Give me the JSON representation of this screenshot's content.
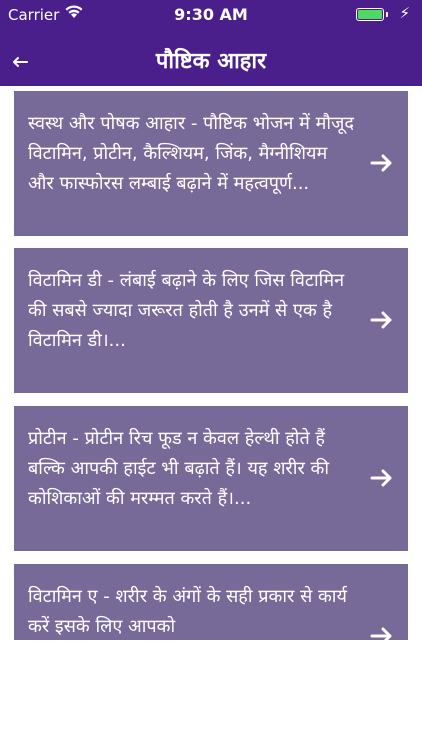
{
  "status": {
    "carrier": "Carrier",
    "time": "9:30 AM",
    "battery_level": 1.0
  },
  "header": {
    "title": "पौष्टिक आहार",
    "back_icon": "left-arrow-icon"
  },
  "articles": [
    {
      "text": "स्वस्थ और पोषक आहार - पौष्टिक भोजन में मौजूद विटामिन, प्रोटीन, कैल्शियम, जिंक, मैग्नीशियम और फास्फोरस लम्बाई बढ़ाने में महत्वपूर्ण..."
    },
    {
      "text": "विटामिन डी - लंबाई बढ़ाने के लिए जिस विटामिन की सबसे ज्यादा जरूरत होती है उनमें से एक है विटामिन डी।..."
    },
    {
      "text": "प्रोटीन - प्रोटीन रिच फूड न केवल हेल्थी होते हैं बल्कि आपकी हाईट भी बढ़ाते हैं। यह शरीर की कोशिकाओं की मरम्मत करते हैं।..."
    },
    {
      "text": "विटामिन ए - शरीर के अंगों के सही प्रकार से कार्य करें इसके लिए आपको"
    }
  ],
  "colors": {
    "header": "#4a1f8c",
    "card": "#776a99",
    "text": "#ffffff"
  }
}
